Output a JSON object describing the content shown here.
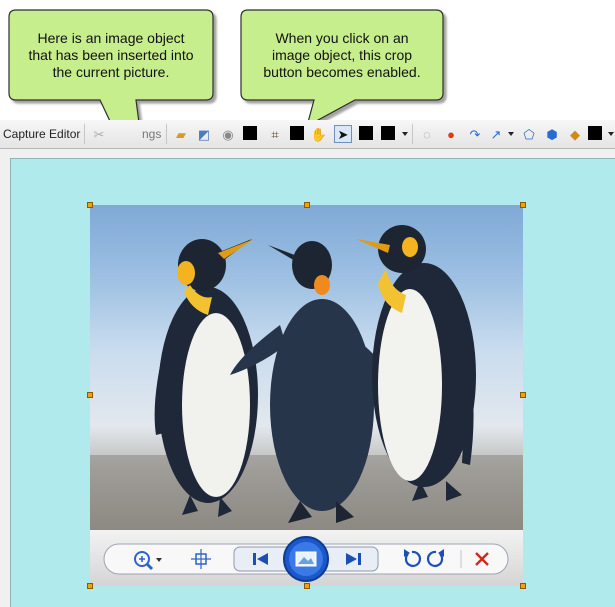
{
  "callouts": {
    "left": [
      "Here is an image object",
      "that has been inserted into",
      "the current picture."
    ],
    "right": [
      "When you click on an",
      "image object, this crop",
      "button becomes enabled."
    ]
  },
  "toolbar": {
    "capture_editor_label": "Capture Editor",
    "settings_label_partial": "ngs"
  },
  "colors": {
    "callout_fill": "#c6ee8c",
    "canvas_background": "#b0eaed",
    "handle": "#f5a200"
  }
}
